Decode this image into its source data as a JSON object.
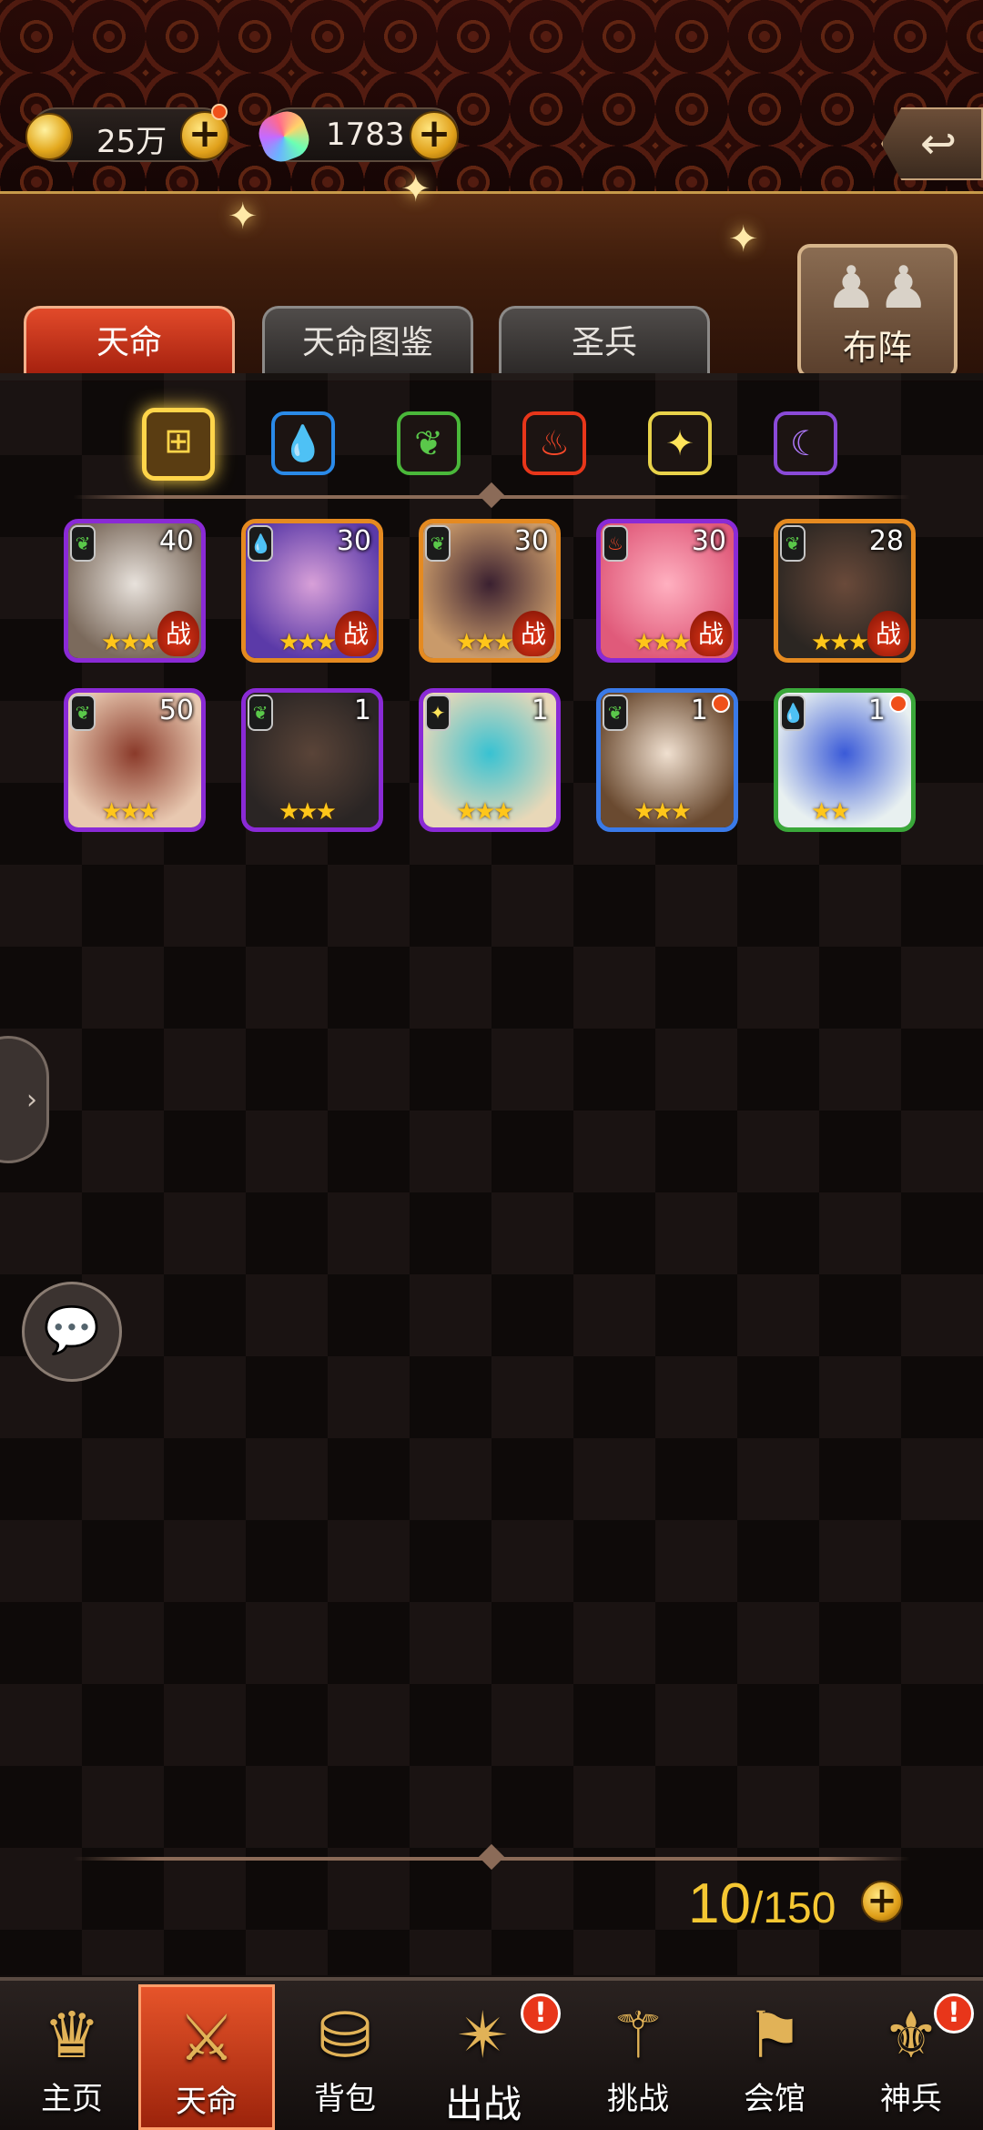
{
  "resources": {
    "gold": "25万",
    "gems": "1783"
  },
  "tabs": [
    "天命",
    "天命图鉴",
    "圣兵"
  ],
  "formation_label": "布阵",
  "filters": [
    "all-icon",
    "water-icon",
    "leaf-icon",
    "fire-icon",
    "star-icon",
    "moon-icon"
  ],
  "heroes": [
    {
      "level": "40",
      "element": "leaf",
      "stars": "★★★",
      "fight": "战",
      "frame": "purple",
      "colors": [
        "#e8e2dc",
        "#7b6a5c"
      ]
    },
    {
      "level": "30",
      "element": "water",
      "stars": "★★★★",
      "fight": "战",
      "frame": "orange",
      "colors": [
        "#d8a0d8",
        "#5b3aa8"
      ]
    },
    {
      "level": "30",
      "element": "leaf",
      "stars": "★★★",
      "fight": "战",
      "frame": "orange",
      "colors": [
        "#3a2030",
        "#c99a6a"
      ]
    },
    {
      "level": "30",
      "element": "fire",
      "stars": "★★★",
      "fight": "战",
      "frame": "purple",
      "colors": [
        "#ffb0c0",
        "#e05a7a"
      ]
    },
    {
      "level": "28",
      "element": "leaf",
      "stars": "★★★",
      "fight": "战",
      "frame": "orange",
      "colors": [
        "#6a4a3a",
        "#2b2622"
      ]
    },
    {
      "level": "50",
      "element": "leaf",
      "stars": "★★★",
      "fight": "",
      "frame": "purple",
      "colors": [
        "#8a3a2a",
        "#e8c8b0"
      ]
    },
    {
      "level": "1",
      "element": "leaf",
      "stars": "★★★",
      "fight": "",
      "frame": "purple",
      "colors": [
        "#5a4438",
        "#2a2524"
      ]
    },
    {
      "level": "1",
      "element": "star",
      "stars": "★★★",
      "fight": "",
      "frame": "purple",
      "colors": [
        "#38c2d2",
        "#e8d8b8"
      ]
    },
    {
      "level": "1",
      "element": "leaf",
      "stars": "★★★",
      "fight": "",
      "frame": "blue",
      "colors": [
        "#f0e0d0",
        "#6a4a30"
      ],
      "dot": true
    },
    {
      "level": "1",
      "element": "water",
      "stars": "★★",
      "fight": "",
      "frame": "green",
      "colors": [
        "#3a5ad8",
        "#e8f0f0"
      ],
      "dot": true
    }
  ],
  "count": {
    "current": "10",
    "max": "/150"
  },
  "nav": [
    {
      "label": "主页",
      "icon": "crown-icon",
      "glyph": "♛"
    },
    {
      "label": "天命",
      "icon": "helmet-icon",
      "glyph": "⚔"
    },
    {
      "label": "背包",
      "icon": "backpack-icon",
      "glyph": "⛁"
    },
    {
      "label": "出战",
      "icon": "battle-icon",
      "glyph": "✴"
    },
    {
      "label": "挑战",
      "icon": "sword-icon",
      "glyph": "⚚"
    },
    {
      "label": "会馆",
      "icon": "banner-icon",
      "glyph": "⚑"
    },
    {
      "label": "神兵",
      "icon": "weapon-icon",
      "glyph": "⚜"
    }
  ]
}
